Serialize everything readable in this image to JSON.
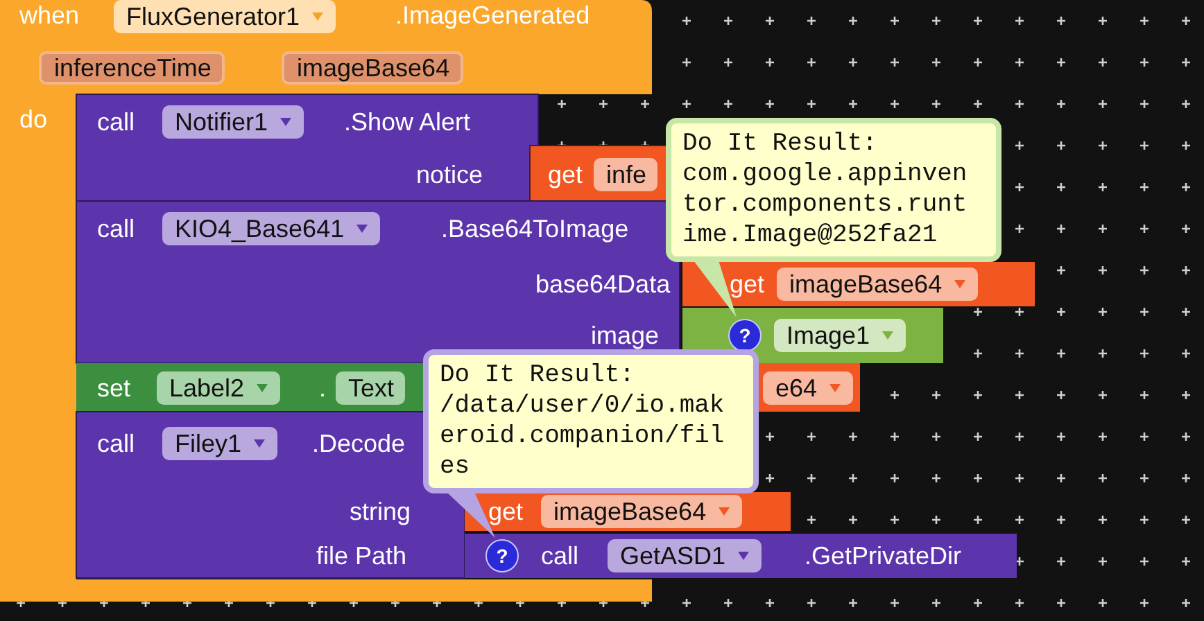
{
  "event": {
    "keyword": "when",
    "component": "FluxGenerator1",
    "name": ".ImageGenerated",
    "parameters": [
      "inferenceTime",
      "imageBase64"
    ],
    "body_label": "do"
  },
  "notifier_call": {
    "keyword": "call",
    "component": "Notifier1",
    "method": ".Show Alert",
    "socket_label": "notice",
    "value": {
      "keyword": "get",
      "variable": "infe"
    }
  },
  "image_call": {
    "keyword": "call",
    "component": "KIO4_Base641",
    "method": ".Base64ToImage",
    "socket_labels": [
      "base64Data",
      "image"
    ],
    "data_value": {
      "keyword": "get",
      "variable": "imageBase64"
    },
    "image_value": {
      "help": "?",
      "component": "Image1"
    }
  },
  "set_block": {
    "keyword": "set",
    "component": "Label2",
    "separator": ".",
    "property": "Text",
    "value_fragment": "e64"
  },
  "decode_call": {
    "keyword": "call",
    "component": "Filey1",
    "method": ".Decode",
    "socket_labels": [
      "string",
      "file Path"
    ],
    "string_value": {
      "keyword": "get",
      "variable": "imageBase64"
    },
    "path_value": {
      "help": "?",
      "keyword": "call",
      "component": "GetASD1",
      "method": ".GetPrivateDir"
    }
  },
  "results": [
    {
      "heading": "Do It Result:",
      "value": "com.google.appinventor.components.runtime.Image@252fa21"
    },
    {
      "heading": "Do It Result:",
      "value": "/data/user/0/io.makeroid.companion/files"
    }
  ]
}
